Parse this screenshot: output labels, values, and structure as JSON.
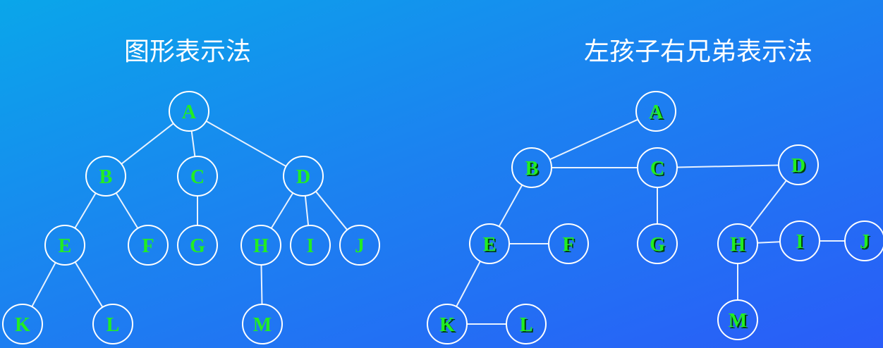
{
  "titles": {
    "left": "图形表示法",
    "right": "左孩子右兄弟表示法"
  },
  "left_tree": {
    "nodes": [
      "A",
      "B",
      "C",
      "D",
      "E",
      "F",
      "G",
      "H",
      "I",
      "J",
      "K",
      "L",
      "M"
    ],
    "edges": [
      [
        "A",
        "B"
      ],
      [
        "A",
        "C"
      ],
      [
        "A",
        "D"
      ],
      [
        "B",
        "E"
      ],
      [
        "B",
        "F"
      ],
      [
        "C",
        "G"
      ],
      [
        "D",
        "H"
      ],
      [
        "D",
        "I"
      ],
      [
        "D",
        "J"
      ],
      [
        "E",
        "K"
      ],
      [
        "E",
        "L"
      ],
      [
        "H",
        "M"
      ]
    ]
  },
  "right_tree": {
    "nodes": [
      "A",
      "B",
      "C",
      "D",
      "E",
      "F",
      "G",
      "H",
      "I",
      "J",
      "K",
      "L",
      "M"
    ],
    "edges": [
      [
        "A",
        "B"
      ],
      [
        "B",
        "C"
      ],
      [
        "C",
        "D"
      ],
      [
        "B",
        "E"
      ],
      [
        "E",
        "F"
      ],
      [
        "C",
        "G"
      ],
      [
        "D",
        "H"
      ],
      [
        "H",
        "I"
      ],
      [
        "I",
        "J"
      ],
      [
        "E",
        "K"
      ],
      [
        "K",
        "L"
      ],
      [
        "H",
        "M"
      ]
    ]
  },
  "colors": {
    "node_label": "#22ee22",
    "edge": "#e8f2ff",
    "node_outline": "#ffffff"
  }
}
